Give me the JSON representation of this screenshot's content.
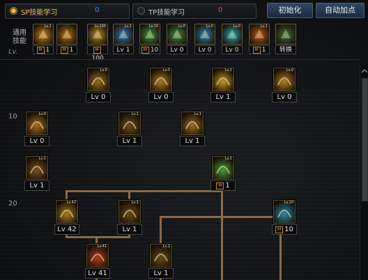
{
  "tabs": [
    {
      "label": "SP技能学习",
      "count": "0",
      "count_color": "#3d8bff",
      "active": true
    },
    {
      "label": "TP技能学习",
      "count": "0",
      "count_color": "#ff3b3b",
      "active": false
    }
  ],
  "buttons": {
    "reset": "初始化",
    "auto": "自动加点"
  },
  "common": {
    "label": "通用技能",
    "lv_note": "Lv.",
    "skills": [
      {
        "top": "Lv.1",
        "val": "1",
        "m": true,
        "color": "#c8861d"
      },
      {
        "top": "",
        "val": "1",
        "m": true,
        "color": "#b6711a"
      },
      {
        "top": "Lv.100",
        "val": "100",
        "m": true,
        "color": "#b58a2a"
      },
      {
        "top": "Lv.1",
        "val": "Lv 1",
        "m": false,
        "color": "#2f7db9"
      },
      {
        "top": "Lv.10",
        "val": "10",
        "m": true,
        "color": "#3f8f40"
      },
      {
        "top": "Lv.0",
        "val": "Lv 0",
        "m": false,
        "color": "#3e8b47"
      },
      {
        "top": "Lv.0",
        "val": "Lv 0",
        "m": false,
        "color": "#2a88b0"
      },
      {
        "top": "Lv.0",
        "val": "Lv 0",
        "m": false,
        "color": "#2aa6b6"
      },
      {
        "top": "Lv.1",
        "val": "1",
        "m": true,
        "color": "#c05a1e"
      },
      {
        "top": "",
        "val": "转换",
        "m": false,
        "color": "#3a6f3c"
      }
    ]
  },
  "rows": {
    "r10": "10",
    "r20": "20",
    "header": "Lv."
  },
  "tree": [
    {
      "id": "a",
      "top": "Lv.0",
      "val": "Lv 0",
      "color": "#9a6a1f"
    },
    {
      "id": "b",
      "top": "Lv.0",
      "val": "Lv 0",
      "color": "#b0761d"
    },
    {
      "id": "c",
      "top": "Lv.1",
      "val": "Lv 1",
      "color": "#c49126"
    },
    {
      "id": "d",
      "top": "Lv.0",
      "val": "Lv 0",
      "color": "#b07a22"
    },
    {
      "id": "e",
      "top": "Lv.0",
      "val": "Lv 0",
      "color": "#a46c1c"
    },
    {
      "id": "f",
      "top": "Lv.1",
      "val": "Lv 1",
      "color": "#6f4a18"
    },
    {
      "id": "g",
      "top": "Lv.1",
      "val": "Lv 1",
      "color": "#9d6b22"
    },
    {
      "id": "h",
      "top": "Lv.1",
      "val": "Lv 1",
      "color": "#7a521b"
    },
    {
      "id": "i",
      "top": "Lv.1",
      "val": "1",
      "color": "#4b9a3a",
      "m": true
    },
    {
      "id": "j",
      "top": "Lv.42",
      "val": "Lv 42",
      "color": "#a57a22"
    },
    {
      "id": "k",
      "top": "Lv.1",
      "val": "Lv 1",
      "color": "#6e4a16"
    },
    {
      "id": "l",
      "top": "Lv.10",
      "val": "10",
      "color": "#2b89a3",
      "m": true
    },
    {
      "id": "m",
      "top": "Lv.41",
      "val": "Lv 41",
      "color": "#b33c1e"
    },
    {
      "id": "n",
      "top": "Lv.1",
      "val": "Lv 1",
      "color": "#6c4a18"
    }
  ]
}
